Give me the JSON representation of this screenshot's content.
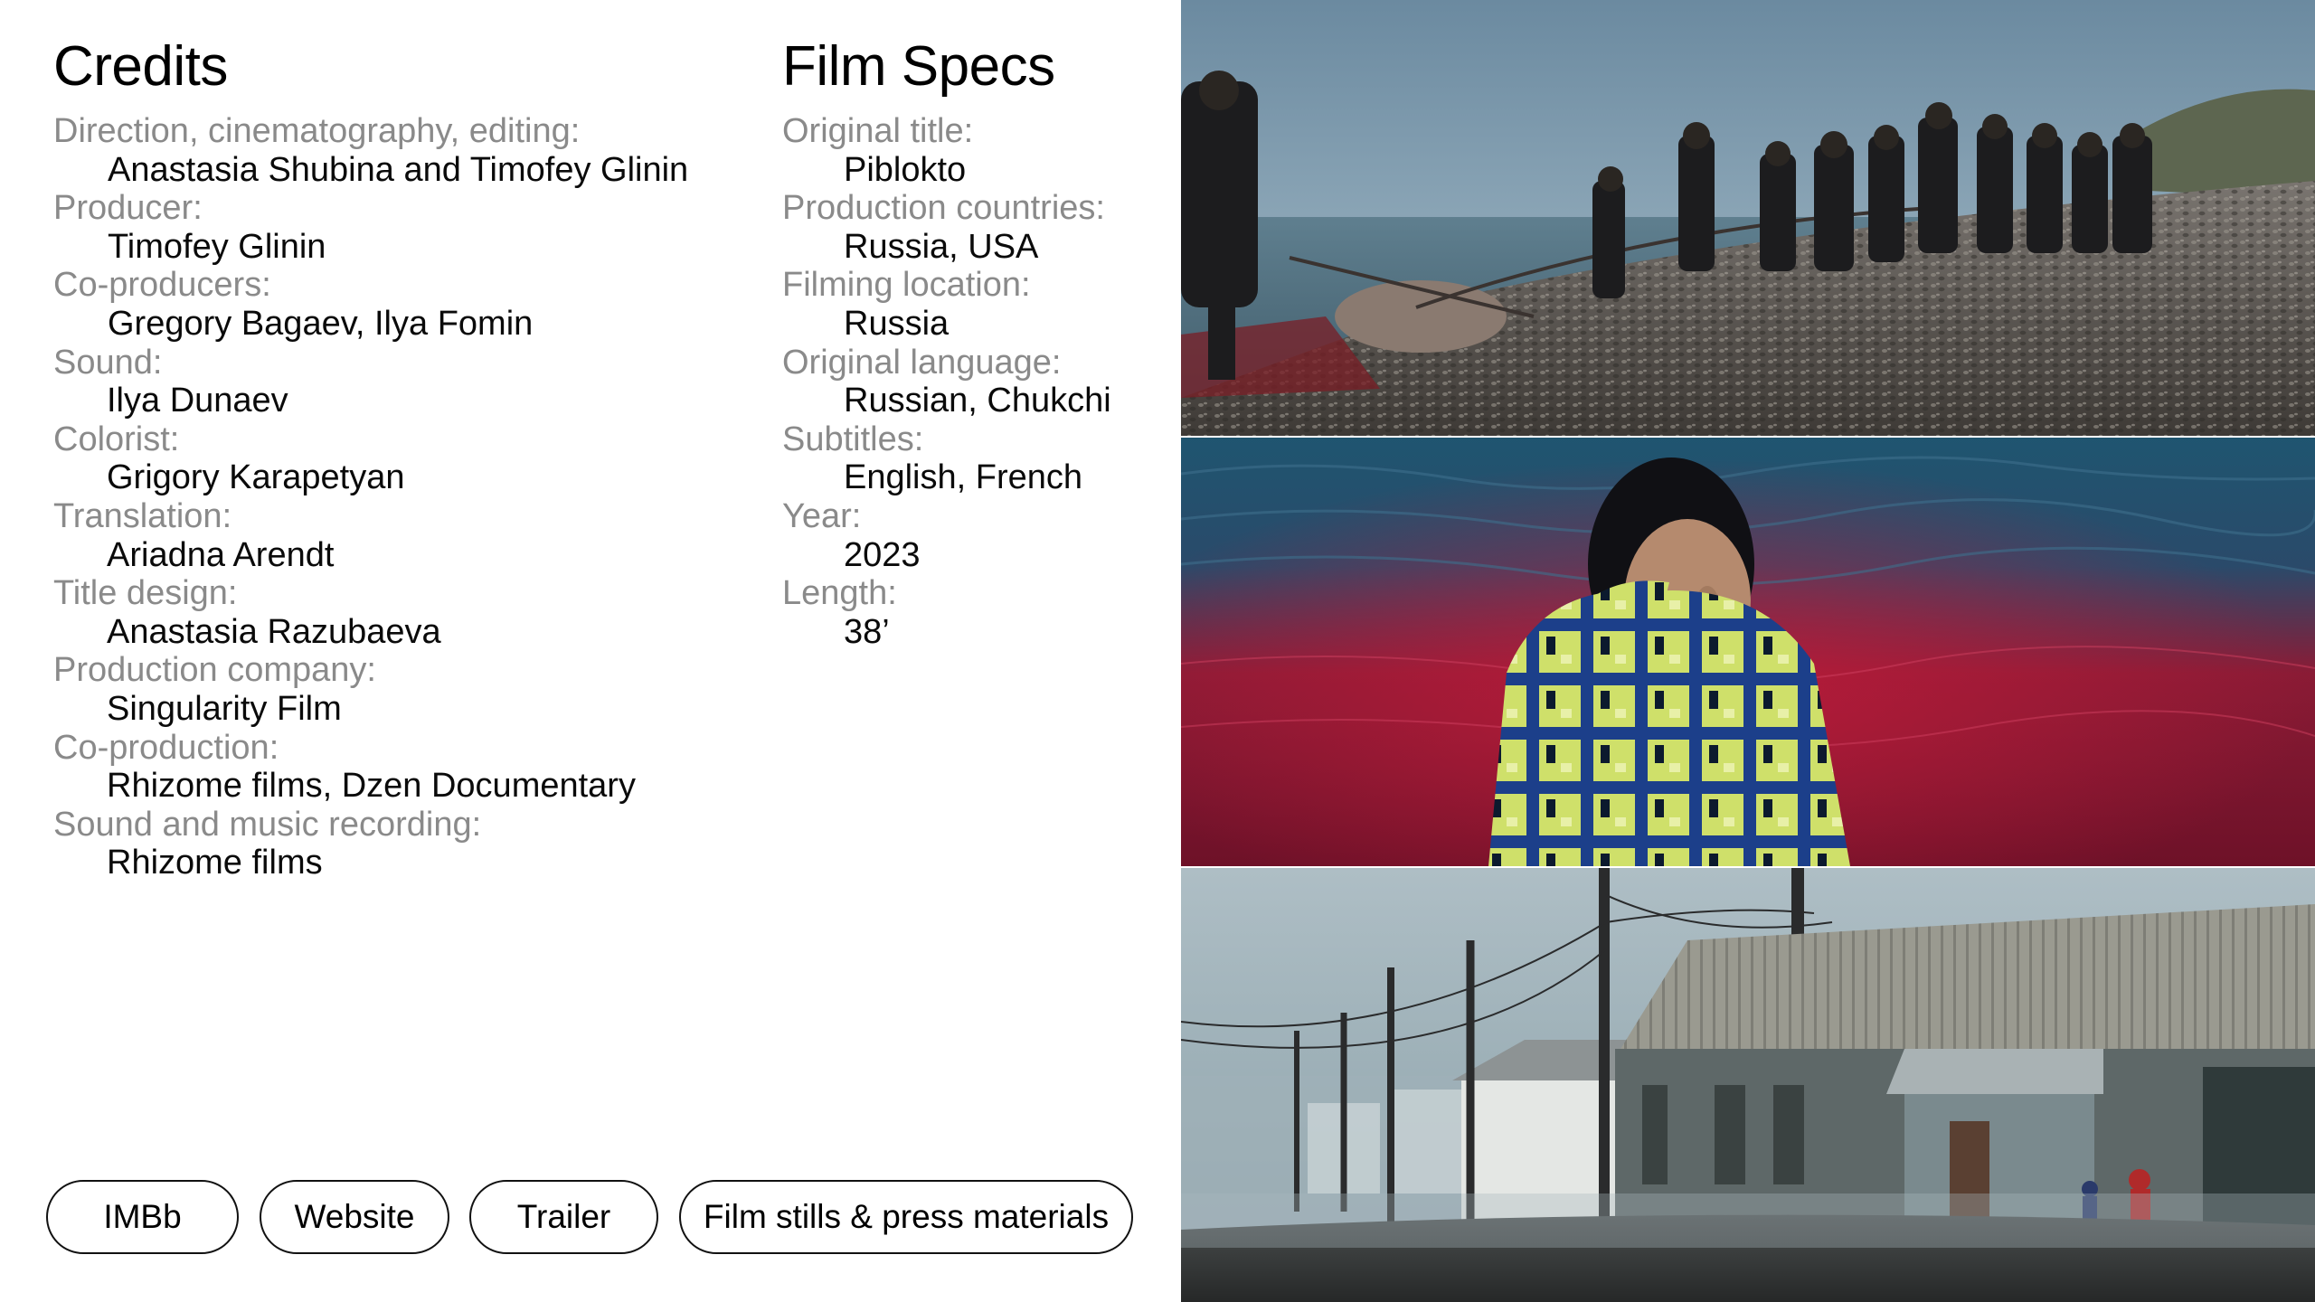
{
  "credits": {
    "heading": "Credits",
    "entries": [
      {
        "label": "Direction, cinematography, editing:",
        "value": "Anastasia Shubina and Timofey Glinin"
      },
      {
        "label": "Producer:",
        "value": "Timofey Glinin"
      },
      {
        "label": "Co-producers:",
        "value": "Gregory Bagaev, Ilya Fomin"
      },
      {
        "label": "Sound:",
        "value": "Ilya Dunaev"
      },
      {
        "label": "Colorist:",
        "value": "Grigory Karapetyan"
      },
      {
        "label": "Translation:",
        "value": "Ariadna Arendt"
      },
      {
        "label": "Title design:",
        "value": "Anastasia Razubaeva"
      },
      {
        "label": "Production company:",
        "value": "Singularity Film"
      },
      {
        "label": "Co-production:",
        "value": "Rhizome films, Dzen Documentary"
      },
      {
        "label": "Sound and music recording:",
        "value": "Rhizome films"
      }
    ]
  },
  "specs": {
    "heading": "Film Specs",
    "entries": [
      {
        "label": "Original title:",
        "value": "Piblokto"
      },
      {
        "label": "Production countries:",
        "value": "Russia, USA"
      },
      {
        "label": "Filming location:",
        "value": "Russia"
      },
      {
        "label": "Original language:",
        "value": "Russian, Chukchi"
      },
      {
        "label": "Subtitles:",
        "value": "English, French"
      },
      {
        "label": "Year:",
        "value": "2023"
      },
      {
        "label": "Length:",
        "value": "38’"
      }
    ]
  },
  "buttons": {
    "imdb": "IMBb",
    "website": "Website",
    "trailer": "Trailer",
    "stills": "Film stills & press materials"
  },
  "colors": {
    "text": "#000000",
    "label": "#8a8a8a",
    "background": "#ffffff",
    "pill_border": "#111111"
  }
}
